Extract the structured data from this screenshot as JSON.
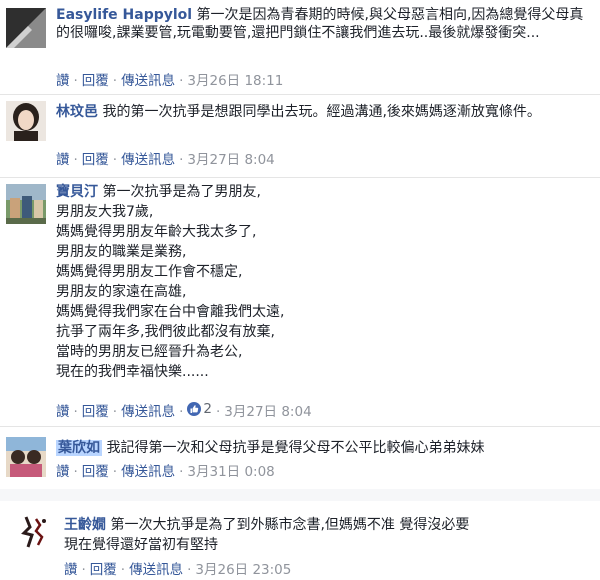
{
  "actions": {
    "like": "讚",
    "reply": "回覆",
    "message": "傳送訊息",
    "sep": "·"
  },
  "comments": [
    {
      "author": "Easylife Happylol",
      "text": "第一次是因為青春期的時候,與父母惡言相向,因為總覺得父母真的很囉唆,課業要管,玩電動要管,還把門鎖住不讓我們進去玩..最後就爆發衝突...",
      "time": "3月26日 18:11"
    },
    {
      "author": "林玟邑",
      "text": "我的第一次抗爭是想跟同學出去玩。經過溝通,後來媽媽逐漸放寬條件。",
      "time": "3月27日 8:04"
    },
    {
      "author": "寶貝汀",
      "text": "第一次抗爭是為了男朋友,\n男朋友大我7歲,\n媽媽覺得男朋友年齡大我太多了,\n男朋友的職業是業務,\n媽媽覺得男朋友工作會不穩定,\n男朋友的家遠在高雄,\n媽媽覺得我們家在台中會離我們太遠,\n抗爭了兩年多,我們彼此都沒有放棄,\n當時的男朋友已經晉升為老公,\n現在的我們幸福快樂......",
      "likes": "2",
      "time": "3月27日 8:04"
    },
    {
      "author": "葉欣如",
      "text": "我記得第一次和父母抗爭是覺得父母不公平比較偏心弟弟妹妹",
      "time": "3月31日 0:08"
    },
    {
      "author": "王齡嫺",
      "text": "第一次大抗爭是為了到外縣市念書,但媽媽不准 覺得沒必要\n現在覺得還好當初有堅持",
      "time": "3月26日 23:05"
    }
  ]
}
